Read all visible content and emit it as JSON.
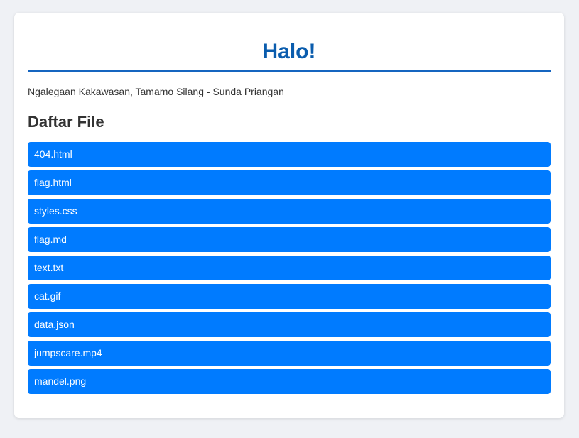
{
  "page": {
    "title": "Halo!",
    "subtitle": "Ngalegaan Kakawasan, Tamamo Silang - Sunda Priangan",
    "section_heading": "Daftar File"
  },
  "files": [
    {
      "label": "404.html"
    },
    {
      "label": "flag.html"
    },
    {
      "label": "styles.css"
    },
    {
      "label": "flag.md"
    },
    {
      "label": "text.txt"
    },
    {
      "label": "cat.gif"
    },
    {
      "label": "data.json"
    },
    {
      "label": "jumpscare.mp4"
    },
    {
      "label": "mandel.png"
    }
  ],
  "colors": {
    "background": "#eff1f5",
    "title": "#0a5cad",
    "accent_rule": "#1565c0",
    "file_button": "#007bff",
    "text": "#333333"
  }
}
